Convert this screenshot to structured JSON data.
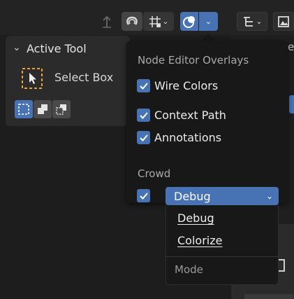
{
  "active_tool": {
    "title": "Active Tool",
    "tool_label": "Select Box"
  },
  "overlays": {
    "heading": "Node Editor Overlays",
    "wire_colors": "Wire Colors",
    "context_path": "Context Path",
    "annotations": "Annotations",
    "crowd_heading": "Crowd",
    "crowd_value": "Debug"
  },
  "crowd_menu": {
    "items": [
      "Debug",
      "Colorize"
    ],
    "footer": "Mode"
  },
  "colors": {
    "accent": "#4772b3",
    "popup_bg": "#181818",
    "panel_bg": "#2b2b2b"
  }
}
